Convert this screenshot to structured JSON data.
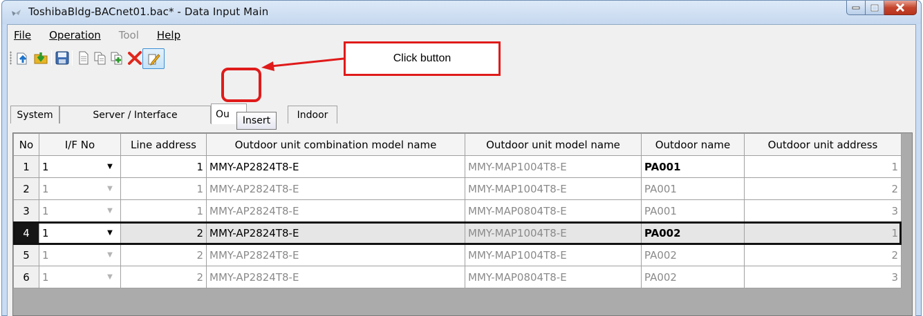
{
  "window": {
    "title": "ToshibaBldg-BACnet01.bac* - Data Input Main"
  },
  "menu": {
    "items": [
      {
        "label": "File",
        "enabled": true
      },
      {
        "label": "Operation",
        "enabled": true
      },
      {
        "label": "Tool",
        "enabled": false
      },
      {
        "label": "Help",
        "enabled": true
      }
    ]
  },
  "toolbar": {
    "buttons": [
      "export-icon",
      "import-icon",
      "save-icon",
      "new-document-icon",
      "copy-icon",
      "paste-icon",
      "delete-icon",
      "insert-icon"
    ],
    "tooltip": "Insert"
  },
  "tabs": [
    {
      "label": "System",
      "active": false
    },
    {
      "label": "Server / Interface",
      "active": false
    },
    {
      "label": "Ou",
      "active": true
    },
    {
      "label": "Indoor",
      "active": false
    }
  ],
  "grid": {
    "columns": [
      "No",
      "I/F No",
      "Line address",
      "Outdoor unit combination model name",
      "Outdoor unit model name",
      "Outdoor name",
      "Outdoor unit address"
    ],
    "rows": [
      {
        "no": "1",
        "if_no": "1",
        "line_address": "1",
        "combo_model": "MMY-AP2824T8-E",
        "model": "MMY-MAP1004T8-E",
        "name": "PA001",
        "address": "1",
        "editable": true,
        "selected": false
      },
      {
        "no": "2",
        "if_no": "1",
        "line_address": "1",
        "combo_model": "MMY-AP2824T8-E",
        "model": "MMY-MAP1004T8-E",
        "name": "PA001",
        "address": "2",
        "editable": false,
        "selected": false
      },
      {
        "no": "3",
        "if_no": "1",
        "line_address": "1",
        "combo_model": "MMY-AP2824T8-E",
        "model": "MMY-MAP0804T8-E",
        "name": "PA001",
        "address": "3",
        "editable": false,
        "selected": false
      },
      {
        "no": "4",
        "if_no": "1",
        "line_address": "2",
        "combo_model": "MMY-AP2824T8-E",
        "model": "MMY-MAP1004T8-E",
        "name": "PA002",
        "address": "1",
        "editable": true,
        "selected": true
      },
      {
        "no": "5",
        "if_no": "1",
        "line_address": "2",
        "combo_model": "MMY-AP2824T8-E",
        "model": "MMY-MAP1004T8-E",
        "name": "PA002",
        "address": "2",
        "editable": false,
        "selected": false
      },
      {
        "no": "6",
        "if_no": "1",
        "line_address": "2",
        "combo_model": "MMY-AP2824T8-E",
        "model": "MMY-MAP0804T8-E",
        "name": "PA002",
        "address": "3",
        "editable": false,
        "selected": false
      }
    ]
  },
  "annotation": {
    "callout_text": "Click button",
    "color": "#e01a1a"
  }
}
